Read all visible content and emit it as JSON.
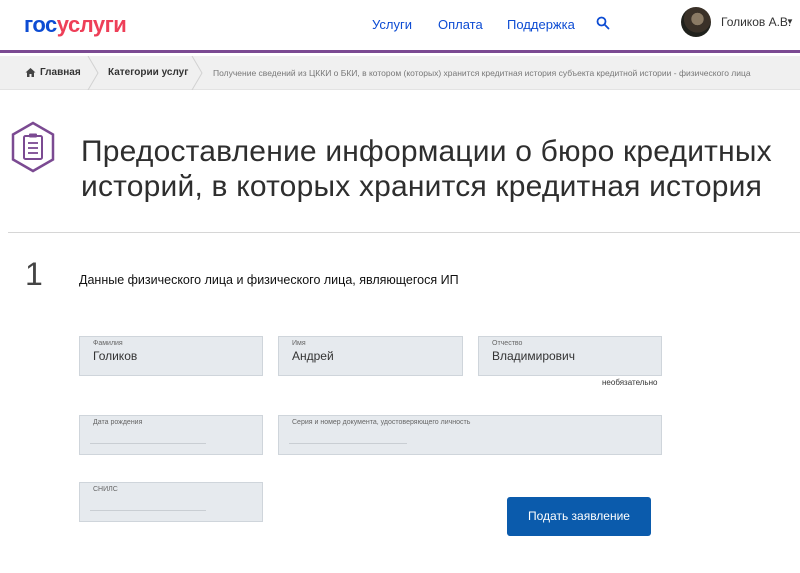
{
  "header": {
    "logo_part1": "гос",
    "logo_part2": "услуги",
    "nav": [
      "Услуги",
      "Оплата",
      "Поддержка"
    ],
    "user_name": "Голиков А.В.",
    "user_caret": "▼"
  },
  "breadcrumbs": {
    "home": "Главная",
    "categories": "Категории услуг",
    "current": "Получение сведений из ЦККИ о БКИ, в котором (которых) хранится кредитная история субъекта кредитной истории - физического лица"
  },
  "page": {
    "title": "Предоставление информации о бюро кредитных историй, в которых хранится кредитная история"
  },
  "step": {
    "number": "1",
    "title": "Данные физического лица и физического лица, являющегося ИП"
  },
  "fields": {
    "surname": {
      "label": "Фамилия",
      "value": "Голиков"
    },
    "name": {
      "label": "Имя",
      "value": "Андрей"
    },
    "patronymic": {
      "label": "Отчество",
      "value": "Владимирович",
      "note": "необязательно"
    },
    "birth_date": {
      "label": "Дата рождения",
      "value": ""
    },
    "document": {
      "label": "Серия и номер документа, удостоверяющего личность",
      "value": ""
    },
    "snils": {
      "label": "СНИЛС",
      "value": ""
    }
  },
  "actions": {
    "submit": "Подать заявление"
  },
  "colors": {
    "brand_blue": "#0d4cd3",
    "brand_red": "#ee3f58",
    "accent_purple": "#7b4a92",
    "button_blue": "#0b5bac",
    "field_bg": "#e6eaee"
  }
}
